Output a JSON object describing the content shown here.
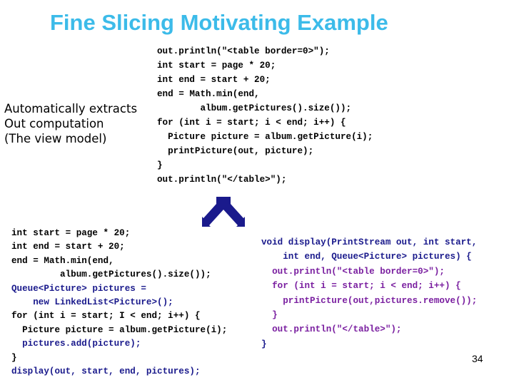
{
  "slide": {
    "title": "Fine Slicing Motivating Example",
    "page_number": "34",
    "note_lines": [
      "Automatically extracts",
      "Out computation",
      "(The view model)"
    ],
    "arrow_icon": "split-arrow-icon",
    "colors": {
      "title": "#3cbbe9",
      "added_code": "#1a1a8c",
      "extracted_code": "#7a1fa0",
      "arrow": "#1a1a8c"
    }
  },
  "original_code": [
    "out.println(\"<table border=0>\");",
    "int start = page * 20;",
    "int end = start + 20;",
    "end = Math.min(end,",
    "        album.getPictures().size());",
    "for (int i = start; i < end; i++) {",
    "  Picture picture = album.getPicture(i);",
    "  printPicture(out, picture);",
    "}",
    "out.println(\"</table>\");"
  ],
  "sliced_code": [
    {
      "text": "int start = page * 20;",
      "style": "plain"
    },
    {
      "text": "int end = start + 20;",
      "style": "plain"
    },
    {
      "text": "end = Math.min(end,",
      "style": "plain"
    },
    {
      "text": "         album.getPictures().size());",
      "style": "plain"
    },
    {
      "text": "Queue<Picture> pictures =",
      "style": "blue"
    },
    {
      "text": "    new LinkedList<Picture>();",
      "style": "blue"
    },
    {
      "text": "for (int i = start; I < end; i++) {",
      "style": "plain"
    },
    {
      "text": "  Picture picture = album.getPicture(i);",
      "style": "plain"
    },
    {
      "text": "  pictures.add(picture);",
      "style": "blue"
    },
    {
      "text": "}",
      "style": "plain"
    },
    {
      "text": "display(out, start, end, pictures);",
      "style": "blue"
    }
  ],
  "extracted_code": [
    {
      "text": "void display(PrintStream out, int start,",
      "style": "navy"
    },
    {
      "text": "    int end, Queue<Picture> pictures) {",
      "style": "navy"
    },
    {
      "text": "  out.println(\"<table border=0>\");",
      "style": "purple"
    },
    {
      "text": "  for (int i = start; i < end; i++) {",
      "style": "purple"
    },
    {
      "text": "    printPicture(out,pictures.remove());",
      "style": "purple"
    },
    {
      "text": "  }",
      "style": "purple"
    },
    {
      "text": "  out.println(\"</table>\");",
      "style": "purple"
    },
    {
      "text": "}",
      "style": "navy"
    }
  ]
}
